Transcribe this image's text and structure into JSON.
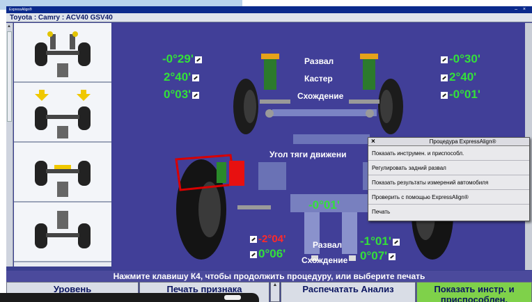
{
  "window": {
    "app_title": "ExpressAlign®",
    "controls": "– ×"
  },
  "vehicle": "Toyota : Camry : ACV40 GSV40",
  "front": {
    "left": {
      "camber": "-0°29'",
      "caster": "2°40'",
      "toe": "0°03'"
    },
    "right": {
      "camber": "-0°30'",
      "caster": "2°40'",
      "toe": "-0°01'"
    },
    "labels": {
      "camber": "Развал",
      "caster": "Кастер",
      "toe": "Схождение"
    }
  },
  "thrust": {
    "label": "Угол тяги движени",
    "value": "-0°01'"
  },
  "rear": {
    "left": {
      "camber": "-2°04'",
      "toe": "0°06'"
    },
    "right": {
      "camber": "-1°01'",
      "toe": "0°07'"
    },
    "labels": {
      "camber": "Развал",
      "toe": "Схождение"
    }
  },
  "menu": {
    "close": "×",
    "title": "Процедура ExpressAlign®",
    "items": [
      "Показать инструмен. и приспособл.",
      "Регулировать задний развал",
      "Показать результаты измерений автомобиля",
      "Проверить с помощью ExpressAlign®",
      "Печать"
    ]
  },
  "status_text": "Нажмите клавишу К4, чтобы продолжить процедуру, или выберите печать",
  "buttons": {
    "level": "Уровень",
    "print_sign": "Печать признака",
    "print_analysis": "Распечатать Анализ",
    "show_tools": "Показать инстр. и приспособлен."
  },
  "colors": {
    "in_spec": "#34e03a",
    "out_of_spec": "#ff2a2a",
    "diagram_bg": "#413f98",
    "accent_button": "#7fd14a"
  }
}
